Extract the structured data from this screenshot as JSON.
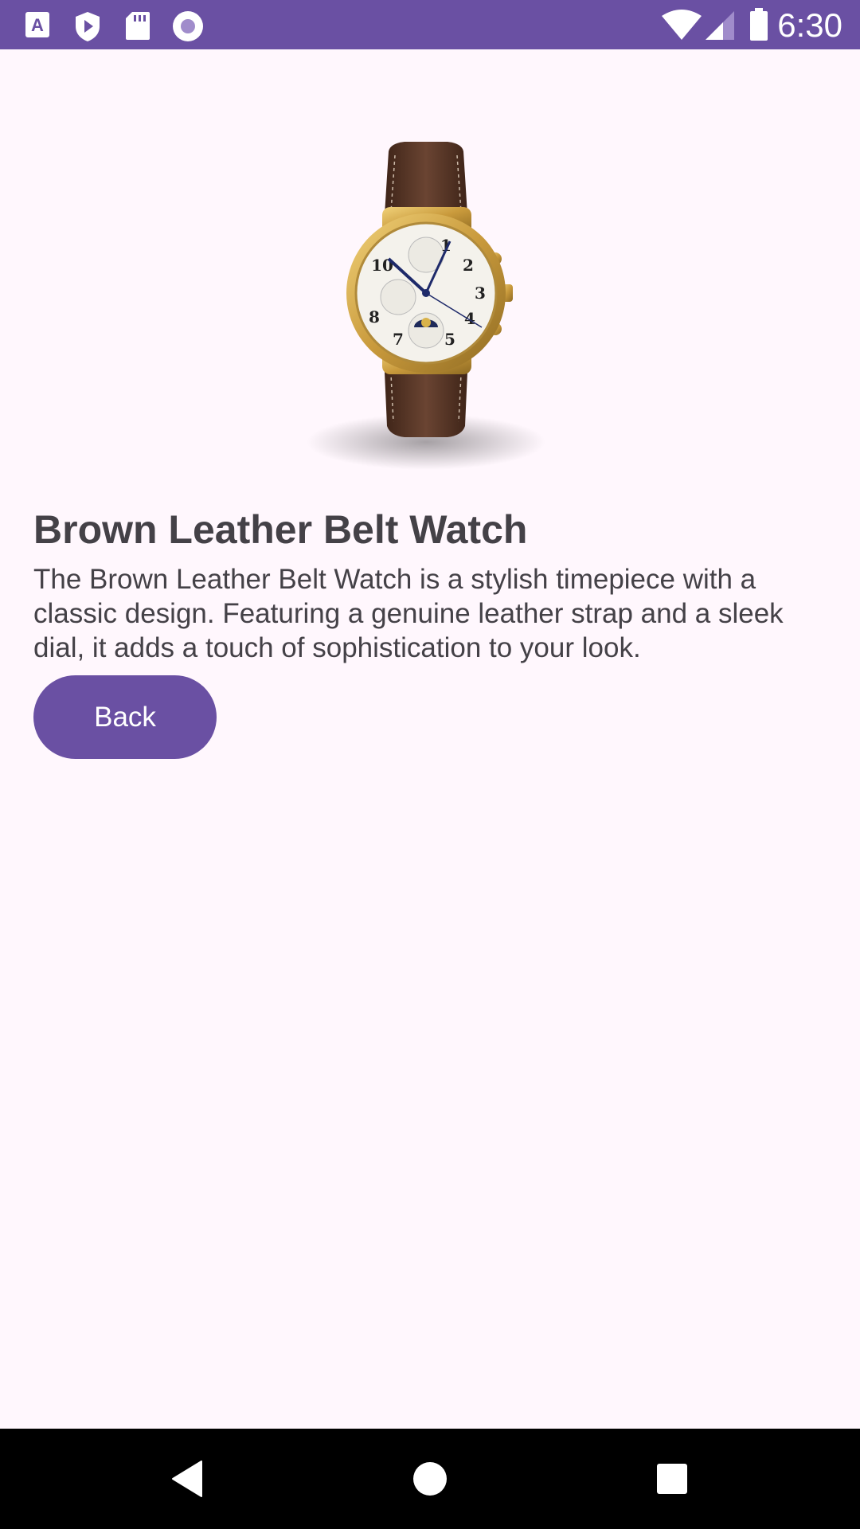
{
  "status_bar": {
    "time": "6:30",
    "background": "#6A50A3",
    "left_icons": [
      "font-badge-icon",
      "play-shield-icon",
      "sd-card-icon",
      "record-circle-icon"
    ],
    "right_icons": [
      "wifi-icon",
      "cellular-signal-icon",
      "battery-icon"
    ]
  },
  "product": {
    "image_icon": "wristwatch-icon",
    "title": "Brown Leather Belt Watch",
    "description": "The Brown Leather Belt Watch is a stylish timepiece with a classic design. Featuring a genuine leather strap and a sleek dial, it adds a touch of sophistication to your look.",
    "back_label": "Back"
  },
  "colors": {
    "accent": "#6A50A3",
    "background": "#FFF7FD",
    "text": "#444147"
  },
  "nav_bar": {
    "buttons": [
      "back-triangle-icon",
      "home-circle-icon",
      "recents-square-icon"
    ]
  }
}
